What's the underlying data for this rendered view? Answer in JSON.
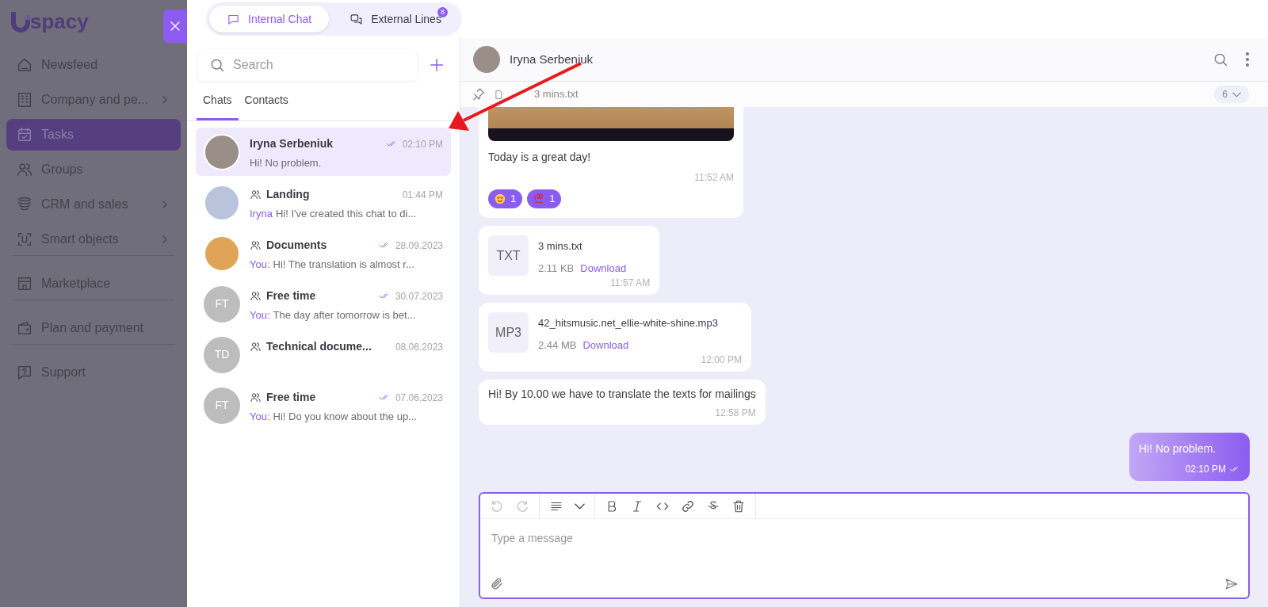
{
  "brand": {
    "logo": "spacy"
  },
  "sidebar": {
    "items": [
      {
        "label": "Newsfeed",
        "expandable": false,
        "selected": false,
        "divider_after": false
      },
      {
        "label": "Company and pe...",
        "expandable": true,
        "selected": false,
        "divider_after": false
      },
      {
        "label": "Tasks",
        "expandable": false,
        "selected": true,
        "divider_after": false
      },
      {
        "label": "Groups",
        "expandable": false,
        "selected": false,
        "divider_after": false
      },
      {
        "label": "CRM and sales",
        "expandable": true,
        "selected": false,
        "divider_after": false
      },
      {
        "label": "Smart objects",
        "expandable": true,
        "selected": false,
        "divider_after": true
      },
      {
        "label": "Marketplace",
        "expandable": false,
        "selected": false,
        "divider_after": true
      },
      {
        "label": "Plan and payment",
        "expandable": false,
        "selected": false,
        "divider_after": true
      },
      {
        "label": "Support",
        "expandable": false,
        "selected": false,
        "divider_after": false
      }
    ]
  },
  "top_tabs": [
    {
      "label": "Internal Chat",
      "selected": true
    },
    {
      "label": "External Lines",
      "selected": false,
      "badge": "8"
    }
  ],
  "chat_list": {
    "search": {
      "placeholder": "Search"
    },
    "tabs": [
      {
        "label": "Chats",
        "selected": true
      },
      {
        "label": "Contacts",
        "selected": false
      }
    ],
    "chats": [
      {
        "name": "Iryna Serbeniuk",
        "group": false,
        "avatar": {
          "kind": "photo"
        },
        "time": "02:10 PM",
        "read": true,
        "preview": "Hi! No problem.",
        "selected": true
      },
      {
        "name": "Landing",
        "group": true,
        "avatar": {
          "kind": "photo"
        },
        "time": "01:44 PM",
        "read": false,
        "sender": "Iryna",
        "preview": "Hi! I've created this chat to di...",
        "selected": false
      },
      {
        "name": "Documents",
        "group": true,
        "avatar": {
          "kind": "photo"
        },
        "time": "28.09.2023",
        "read": true,
        "sender": "You:",
        "preview": "Hi! The translation is almost r...",
        "selected": false
      },
      {
        "name": "Free time",
        "group": true,
        "avatar": {
          "kind": "initials",
          "text": "FT"
        },
        "time": "30.07.2023",
        "read": true,
        "sender": "You:",
        "preview": "The day after tomorrow is bet...",
        "selected": false
      },
      {
        "name": "Technical docume...",
        "group": true,
        "avatar": {
          "kind": "initials",
          "text": "TD"
        },
        "time": "08.06.2023",
        "read": false,
        "selected": false
      },
      {
        "name": "Free time",
        "group": true,
        "avatar": {
          "kind": "initials",
          "text": "FT"
        },
        "time": "07.06.2023",
        "read": true,
        "sender": "You:",
        "preview": "Hi! Do you know about the up...",
        "selected": false
      }
    ]
  },
  "chat": {
    "title": "Iryna Serbeniuk",
    "pinned": {
      "file": "3 mins.txt",
      "count": "6"
    },
    "messages": [
      {
        "kind": "image",
        "text": "Today is a great day!",
        "time": "11:52 AM",
        "reactions": [
          {
            "kind": "heart-eyes",
            "count": "1"
          },
          {
            "kind": "hundred",
            "count": "1"
          }
        ]
      },
      {
        "kind": "file",
        "ext": "TXT",
        "file": "3 mins.txt",
        "size": "2.11 KB",
        "link": "Download",
        "time": "11:57 AM"
      },
      {
        "kind": "file",
        "ext": "MP3",
        "file": "42_hitsmusic.net_ellie-white-shine.mp3",
        "size": "2.44 MB",
        "link": "Download",
        "time": "12:00 PM"
      },
      {
        "kind": "text",
        "text": "Hi! By 10.00 we have to translate the texts for mailings",
        "time": "12:58 PM"
      },
      {
        "kind": "outgoing",
        "text": "Hi! No problem.",
        "time": "02:10 PM",
        "read": true
      }
    ]
  },
  "composer": {
    "placeholder": "Type a message"
  }
}
